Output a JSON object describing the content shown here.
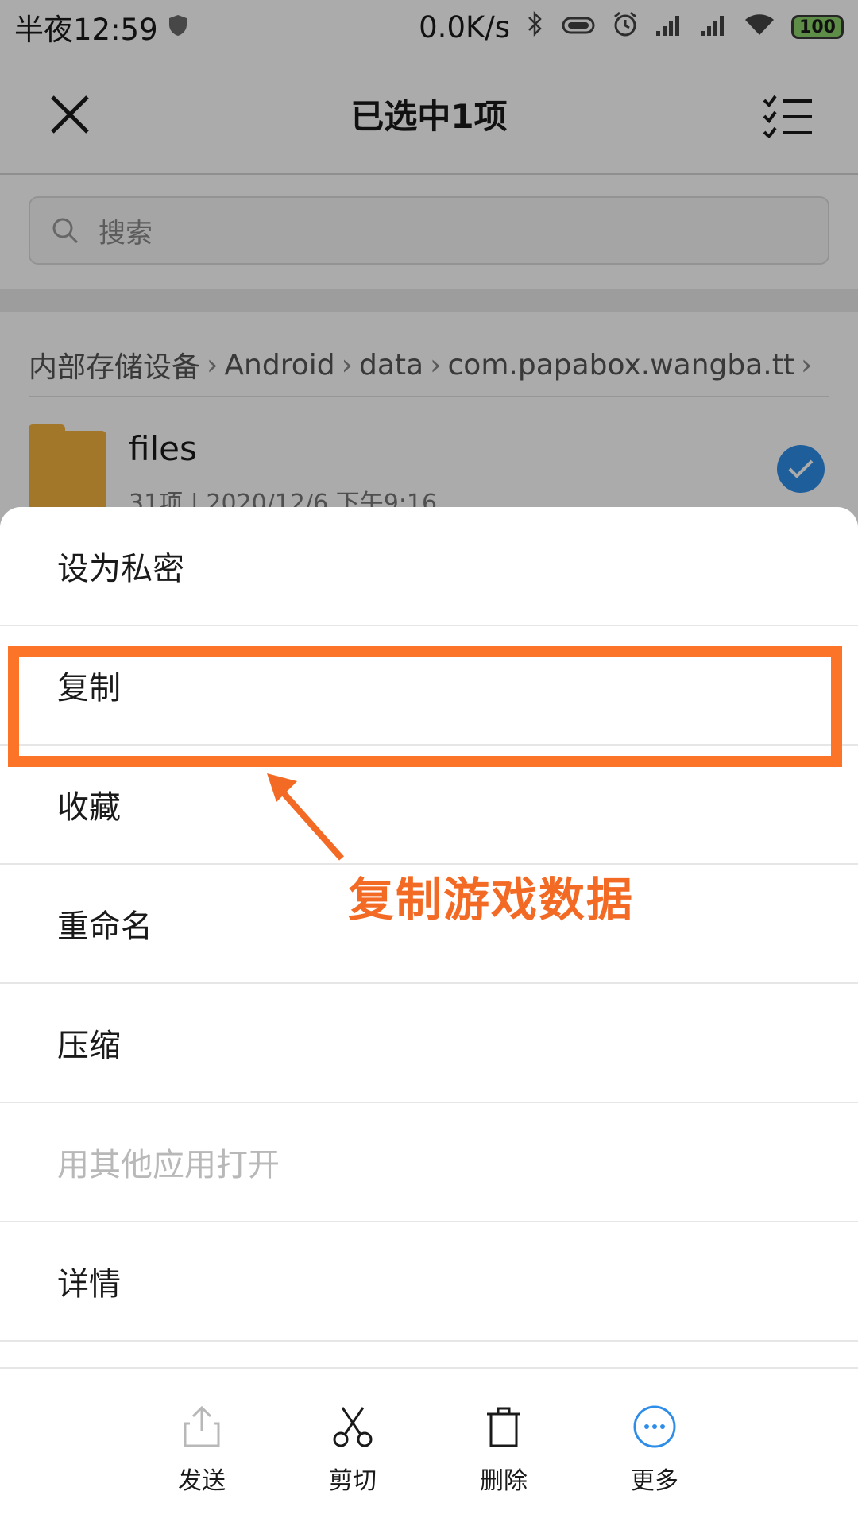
{
  "status_bar": {
    "time": "半夜12:59",
    "net_speed": "0.0K/s",
    "battery": "100"
  },
  "title_bar": {
    "title": "已选中1项",
    "close_icon": "close-icon",
    "select_all_icon": "checklist-icon"
  },
  "search": {
    "placeholder": "搜索"
  },
  "breadcrumb": {
    "items": [
      "内部存储设备",
      "Android",
      "data",
      "com.papabox.wangba.tt"
    ]
  },
  "file": {
    "name": "files",
    "meta": "31项 | 2020/12/6 下午9:16",
    "selected": true
  },
  "menu": {
    "items": [
      {
        "label": "设为私密",
        "enabled": true
      },
      {
        "label": "复制",
        "enabled": true
      },
      {
        "label": "收藏",
        "enabled": true
      },
      {
        "label": "重命名",
        "enabled": true
      },
      {
        "label": "压缩",
        "enabled": true
      },
      {
        "label": "用其他应用打开",
        "enabled": false
      },
      {
        "label": "详情",
        "enabled": true
      }
    ]
  },
  "annotation": {
    "text": "复制游戏数据",
    "color": "#f36a25"
  },
  "actions": [
    {
      "label": "发送",
      "icon": "share-icon",
      "enabled": false
    },
    {
      "label": "剪切",
      "icon": "scissors-icon",
      "enabled": true
    },
    {
      "label": "删除",
      "icon": "trash-icon",
      "enabled": true
    },
    {
      "label": "更多",
      "icon": "more-icon",
      "enabled": true
    }
  ],
  "colors": {
    "accent": "#2e8de8",
    "highlight": "#fb7427",
    "folder": "#f3b23e"
  }
}
